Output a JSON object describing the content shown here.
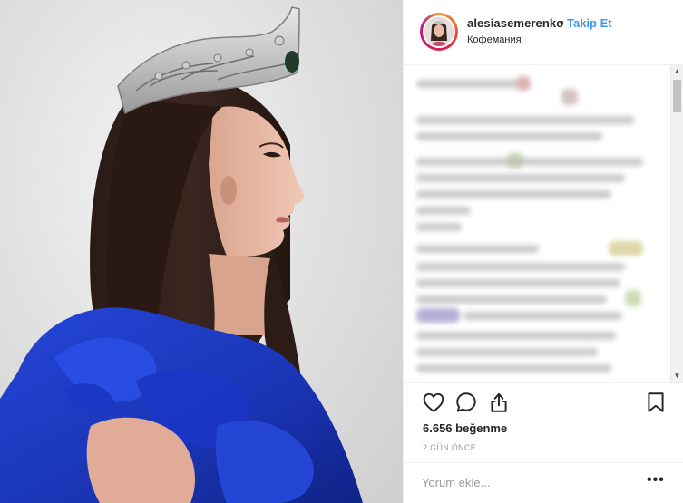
{
  "post": {
    "username": "alesiasemerenko",
    "separator": "•",
    "follow_label": "Takip Et",
    "location": "Кофемания",
    "likes": "6.656 beğenme",
    "time_ago": "2 GÜN ÖNCE",
    "comment_placeholder": "Yorum ekle...",
    "more_label": "•••"
  },
  "icons": {
    "like": "heart-icon",
    "comment": "comment-bubble-icon",
    "share": "share-upload-icon",
    "save": "bookmark-icon",
    "scroll_up": "triangle-up-icon",
    "scroll_down": "triangle-down-icon"
  },
  "colors": {
    "follow_link": "#3897f0",
    "text": "#262626",
    "muted": "#999999",
    "border": "#efefef",
    "dress_blue": "#1f3fc8"
  }
}
